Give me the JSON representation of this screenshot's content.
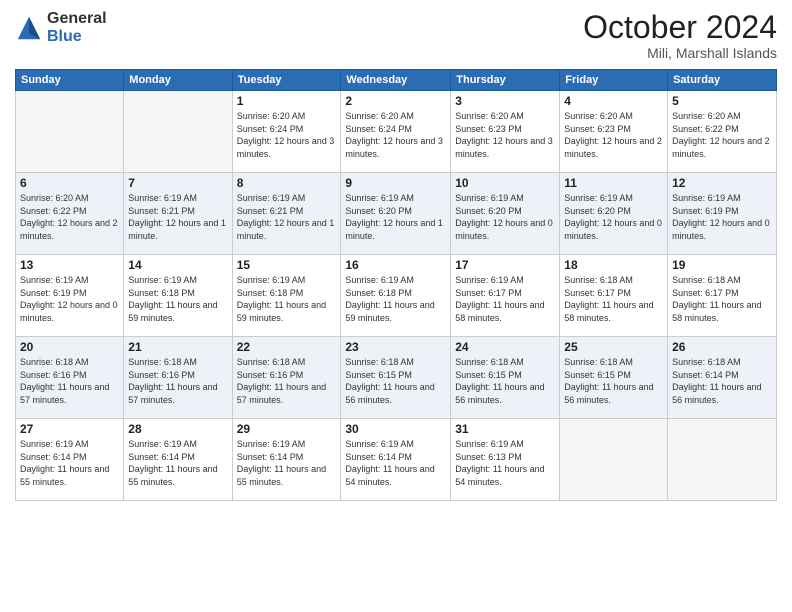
{
  "logo": {
    "general": "General",
    "blue": "Blue"
  },
  "title": {
    "month": "October 2024",
    "location": "Mili, Marshall Islands"
  },
  "headers": [
    "Sunday",
    "Monday",
    "Tuesday",
    "Wednesday",
    "Thursday",
    "Friday",
    "Saturday"
  ],
  "weeks": [
    [
      {
        "day": "",
        "sunrise": "",
        "sunset": "",
        "daylight": ""
      },
      {
        "day": "",
        "sunrise": "",
        "sunset": "",
        "daylight": ""
      },
      {
        "day": "1",
        "sunrise": "Sunrise: 6:20 AM",
        "sunset": "Sunset: 6:24 PM",
        "daylight": "Daylight: 12 hours and 3 minutes."
      },
      {
        "day": "2",
        "sunrise": "Sunrise: 6:20 AM",
        "sunset": "Sunset: 6:24 PM",
        "daylight": "Daylight: 12 hours and 3 minutes."
      },
      {
        "day": "3",
        "sunrise": "Sunrise: 6:20 AM",
        "sunset": "Sunset: 6:23 PM",
        "daylight": "Daylight: 12 hours and 3 minutes."
      },
      {
        "day": "4",
        "sunrise": "Sunrise: 6:20 AM",
        "sunset": "Sunset: 6:23 PM",
        "daylight": "Daylight: 12 hours and 2 minutes."
      },
      {
        "day": "5",
        "sunrise": "Sunrise: 6:20 AM",
        "sunset": "Sunset: 6:22 PM",
        "daylight": "Daylight: 12 hours and 2 minutes."
      }
    ],
    [
      {
        "day": "6",
        "sunrise": "Sunrise: 6:20 AM",
        "sunset": "Sunset: 6:22 PM",
        "daylight": "Daylight: 12 hours and 2 minutes."
      },
      {
        "day": "7",
        "sunrise": "Sunrise: 6:19 AM",
        "sunset": "Sunset: 6:21 PM",
        "daylight": "Daylight: 12 hours and 1 minute."
      },
      {
        "day": "8",
        "sunrise": "Sunrise: 6:19 AM",
        "sunset": "Sunset: 6:21 PM",
        "daylight": "Daylight: 12 hours and 1 minute."
      },
      {
        "day": "9",
        "sunrise": "Sunrise: 6:19 AM",
        "sunset": "Sunset: 6:20 PM",
        "daylight": "Daylight: 12 hours and 1 minute."
      },
      {
        "day": "10",
        "sunrise": "Sunrise: 6:19 AM",
        "sunset": "Sunset: 6:20 PM",
        "daylight": "Daylight: 12 hours and 0 minutes."
      },
      {
        "day": "11",
        "sunrise": "Sunrise: 6:19 AM",
        "sunset": "Sunset: 6:20 PM",
        "daylight": "Daylight: 12 hours and 0 minutes."
      },
      {
        "day": "12",
        "sunrise": "Sunrise: 6:19 AM",
        "sunset": "Sunset: 6:19 PM",
        "daylight": "Daylight: 12 hours and 0 minutes."
      }
    ],
    [
      {
        "day": "13",
        "sunrise": "Sunrise: 6:19 AM",
        "sunset": "Sunset: 6:19 PM",
        "daylight": "Daylight: 12 hours and 0 minutes."
      },
      {
        "day": "14",
        "sunrise": "Sunrise: 6:19 AM",
        "sunset": "Sunset: 6:18 PM",
        "daylight": "Daylight: 11 hours and 59 minutes."
      },
      {
        "day": "15",
        "sunrise": "Sunrise: 6:19 AM",
        "sunset": "Sunset: 6:18 PM",
        "daylight": "Daylight: 11 hours and 59 minutes."
      },
      {
        "day": "16",
        "sunrise": "Sunrise: 6:19 AM",
        "sunset": "Sunset: 6:18 PM",
        "daylight": "Daylight: 11 hours and 59 minutes."
      },
      {
        "day": "17",
        "sunrise": "Sunrise: 6:19 AM",
        "sunset": "Sunset: 6:17 PM",
        "daylight": "Daylight: 11 hours and 58 minutes."
      },
      {
        "day": "18",
        "sunrise": "Sunrise: 6:18 AM",
        "sunset": "Sunset: 6:17 PM",
        "daylight": "Daylight: 11 hours and 58 minutes."
      },
      {
        "day": "19",
        "sunrise": "Sunrise: 6:18 AM",
        "sunset": "Sunset: 6:17 PM",
        "daylight": "Daylight: 11 hours and 58 minutes."
      }
    ],
    [
      {
        "day": "20",
        "sunrise": "Sunrise: 6:18 AM",
        "sunset": "Sunset: 6:16 PM",
        "daylight": "Daylight: 11 hours and 57 minutes."
      },
      {
        "day": "21",
        "sunrise": "Sunrise: 6:18 AM",
        "sunset": "Sunset: 6:16 PM",
        "daylight": "Daylight: 11 hours and 57 minutes."
      },
      {
        "day": "22",
        "sunrise": "Sunrise: 6:18 AM",
        "sunset": "Sunset: 6:16 PM",
        "daylight": "Daylight: 11 hours and 57 minutes."
      },
      {
        "day": "23",
        "sunrise": "Sunrise: 6:18 AM",
        "sunset": "Sunset: 6:15 PM",
        "daylight": "Daylight: 11 hours and 56 minutes."
      },
      {
        "day": "24",
        "sunrise": "Sunrise: 6:18 AM",
        "sunset": "Sunset: 6:15 PM",
        "daylight": "Daylight: 11 hours and 56 minutes."
      },
      {
        "day": "25",
        "sunrise": "Sunrise: 6:18 AM",
        "sunset": "Sunset: 6:15 PM",
        "daylight": "Daylight: 11 hours and 56 minutes."
      },
      {
        "day": "26",
        "sunrise": "Sunrise: 6:18 AM",
        "sunset": "Sunset: 6:14 PM",
        "daylight": "Daylight: 11 hours and 56 minutes."
      }
    ],
    [
      {
        "day": "27",
        "sunrise": "Sunrise: 6:19 AM",
        "sunset": "Sunset: 6:14 PM",
        "daylight": "Daylight: 11 hours and 55 minutes."
      },
      {
        "day": "28",
        "sunrise": "Sunrise: 6:19 AM",
        "sunset": "Sunset: 6:14 PM",
        "daylight": "Daylight: 11 hours and 55 minutes."
      },
      {
        "day": "29",
        "sunrise": "Sunrise: 6:19 AM",
        "sunset": "Sunset: 6:14 PM",
        "daylight": "Daylight: 11 hours and 55 minutes."
      },
      {
        "day": "30",
        "sunrise": "Sunrise: 6:19 AM",
        "sunset": "Sunset: 6:14 PM",
        "daylight": "Daylight: 11 hours and 54 minutes."
      },
      {
        "day": "31",
        "sunrise": "Sunrise: 6:19 AM",
        "sunset": "Sunset: 6:13 PM",
        "daylight": "Daylight: 11 hours and 54 minutes."
      },
      {
        "day": "",
        "sunrise": "",
        "sunset": "",
        "daylight": ""
      },
      {
        "day": "",
        "sunrise": "",
        "sunset": "",
        "daylight": ""
      }
    ]
  ]
}
